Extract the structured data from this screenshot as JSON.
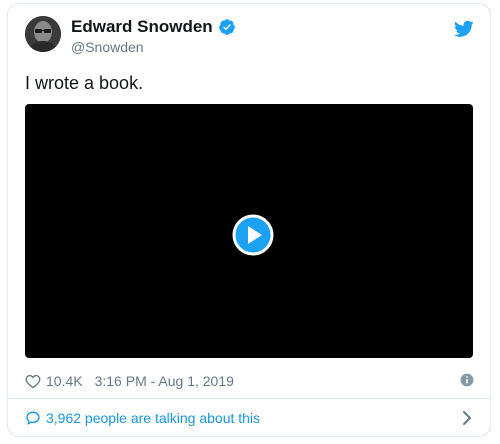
{
  "author": {
    "name": "Edward Snowden",
    "handle": "@Snowden"
  },
  "tweet": {
    "text": "I wrote a book."
  },
  "meta": {
    "likes": "10.4K",
    "timestamp": "3:16 PM - Aug 1, 2019"
  },
  "footer": {
    "talking": "3,962 people are talking about this"
  },
  "colors": {
    "accent": "#1da1f2",
    "link": "#1b95e0",
    "muted": "#657786",
    "media_bg": "#000000"
  },
  "icons": {
    "verified": "verified-badge-icon",
    "twitter": "twitter-bird-icon",
    "play": "play-icon",
    "heart": "heart-icon",
    "info": "info-icon",
    "bubble": "speech-bubble-icon",
    "chevron": "chevron-right-icon"
  }
}
